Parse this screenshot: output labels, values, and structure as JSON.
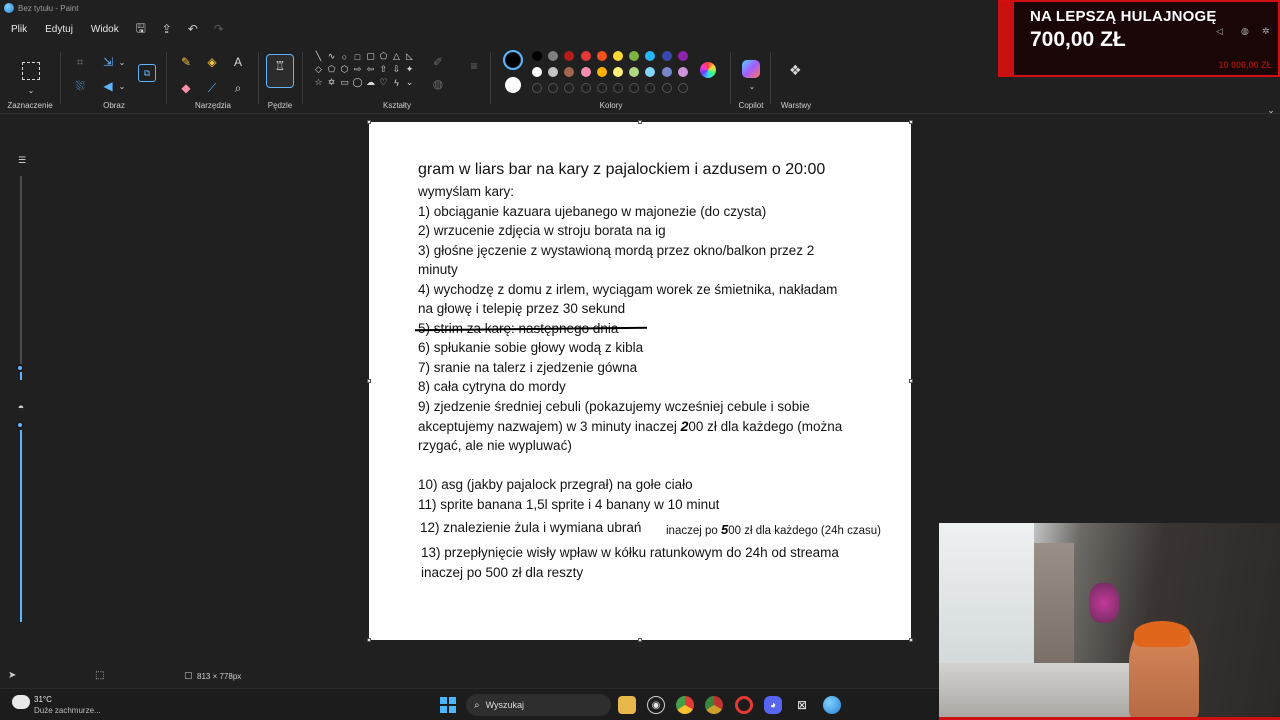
{
  "window": {
    "title": "Bez tytułu - Paint"
  },
  "menu": {
    "items": [
      "Plik",
      "Edytuj",
      "Widok"
    ],
    "icons": [
      "save-icon",
      "share-icon",
      "undo-icon",
      "redo-icon"
    ]
  },
  "ribbon": {
    "groups": {
      "selection": "Zaznaczenie",
      "image": "Obraz",
      "tools": "Narzędzia",
      "brushes": "Pędzle",
      "shapes": "Kształty",
      "colors": "Kolory",
      "copilot": "Copilot",
      "layers": "Warstwy"
    },
    "palette_row1": [
      "#000000",
      "#7f7f7f",
      "#b71c1c",
      "#e53935",
      "#f4511e",
      "#fdd835",
      "#7cb342",
      "#29b6f6",
      "#3949ab",
      "#8e24aa"
    ],
    "palette_row2": [
      "#ffffff",
      "#c3c3c3",
      "#a1664b",
      "#f48fb1",
      "#ffb300",
      "#fff176",
      "#aed581",
      "#81d4fa",
      "#7986cb",
      "#ce93d8"
    ],
    "primary_color": "#000000",
    "secondary_color": "#ffffff"
  },
  "canvas": {
    "title": "gram w liars bar na kary z pajalockiem i azdusem o 20:00",
    "lines": [
      "wymyślam kary:",
      "1) obciąganie kazuara ujebanego w majonezie (do czysta)",
      "2) wrzucenie zdjęcia w stroju borata na ig",
      "3) głośne jęczenie z wystawioną mordą przez okno/balkon przez 2",
      "minuty",
      "4) wychodzę z domu z irlem, wyciągam worek ze śmietnika, nakładam",
      "na głowę i telepię przez 30 sekund",
      "5) strim za karę: następnego dnia",
      "6) spłukanie sobie głowy wodą z kibla",
      "7) sranie na talerz i zjedzenie gówna",
      "8) cała cytryna do mordy",
      "9) zjedzenie  średniej cebuli (pokazujemy wcześniej cebule i sobie",
      "akceptujemy nazwajem) w 3 minuty inaczej ",
      "00 zł dla każdego (można",
      "rzygać, ale nie wypluwać)",
      "10) asg (jakby pajalock przegrał) na gołe ciało",
      "11) sprite banana 1,5l sprite i 4 banany w 10 minut",
      "12) znalezienie żula i wymiana ubrań",
      "inaczej po ",
      "00 zł dla każdego (24h czasu)",
      "13) przepłynięcie wisły wpław w kółku ratunkowym do 24h od streama",
      "inaczej po 500 zł dla reszty"
    ],
    "scribbles": [
      "2",
      "5"
    ]
  },
  "status": {
    "size": "813 × 778px"
  },
  "overlay": {
    "donation_line1": "NA LEPSZĄ HULAJNOGĘ",
    "donation_line2": "700,00 ZŁ",
    "donation_goal": "10 000,00 ZŁ"
  },
  "taskbar": {
    "temperature": "31°C",
    "weather": "Duże zachmurze...",
    "search_placeholder": "Wyszukaj"
  }
}
